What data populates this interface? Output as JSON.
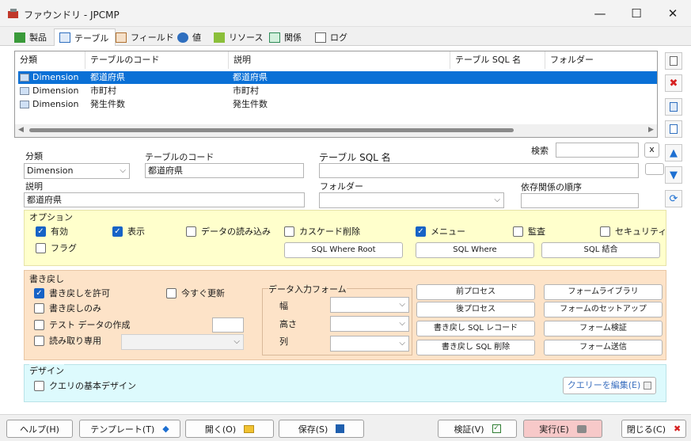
{
  "window": {
    "title": "ファウンドリ - JPCMP"
  },
  "tabs": [
    "製品",
    "テーブル",
    "フィールド",
    "値",
    "リソース",
    "関係",
    "ログ"
  ],
  "grid": {
    "columns": [
      "分類",
      "テーブルのコード",
      "説明",
      "テーブル SQL 名",
      "フォルダー"
    ],
    "rows": [
      {
        "category": "Dimension",
        "code": "都道府県",
        "desc": "都道府県"
      },
      {
        "category": "Dimension",
        "code": "市町村",
        "desc": "市町村"
      },
      {
        "category": "Dimension",
        "code": "発生件数",
        "desc": "発生件数"
      }
    ]
  },
  "form": {
    "category_label": "分類",
    "category_value": "Dimension",
    "code_label": "テーブルのコード",
    "code_value": "都道府県",
    "sqlname_label": "テーブル SQL 名",
    "sqlname_value": "",
    "search_label": "検索",
    "search_value": "",
    "search_clear": "x",
    "desc_label": "説明",
    "desc_value": "都道府県",
    "folder_label": "フォルダー",
    "folder_value": "",
    "deporder_label": "依存関係の順序",
    "deporder_value": ""
  },
  "options": {
    "title": "オプション",
    "enabled": "有効",
    "display": "表示",
    "dataload": "データの読み込み",
    "cascade": "カスケード削除",
    "menu": "メニュー",
    "audit": "監査",
    "security": "セキュリティ",
    "flag": "フラグ",
    "btn_where_root": "SQL Where Root",
    "btn_where": "SQL Where",
    "btn_join": "SQL 結合"
  },
  "writeback": {
    "title": "書き戻し",
    "allow": "書き戻しを許可",
    "update_now": "今すぐ更新",
    "only": "書き戻しのみ",
    "testdata": "テスト データの作成",
    "readonly": "読み取り専用",
    "form_title": "データ入力フォーム",
    "width": "幅",
    "height": "高さ",
    "column": "列",
    "btn_preprocess": "前プロセス",
    "btn_postprocess": "後プロセス",
    "btn_wb_record": "書き戻し SQL レコード",
    "btn_wb_delete": "書き戻し SQL 削除",
    "btn_form_lib": "フォームライブラリ",
    "btn_form_setup": "フォームのセットアップ",
    "btn_form_verify": "フォーム検証",
    "btn_form_send": "フォーム送信"
  },
  "design": {
    "title": "デザイン",
    "query_basic": "クエリの基本デザイン",
    "edit_query": "クエリーを編集(E)"
  },
  "footer": {
    "help": "ヘルプ(H)",
    "template": "テンプレート(T)",
    "open": "開く(O)",
    "save": "保存(S)",
    "verify": "検証(V)",
    "run": "実行(E)",
    "close": "閉じる(C)"
  },
  "colors": {
    "selection": "#0a70d6",
    "options_bg": "#ffffcc",
    "writeback_bg": "#fde3c8",
    "design_bg": "#ddfafd",
    "run_bg": "#f7c9c9"
  }
}
